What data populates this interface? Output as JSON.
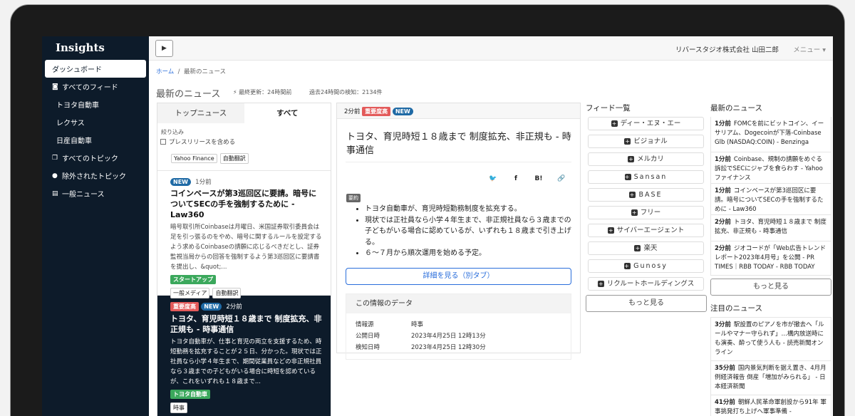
{
  "sidebar": {
    "brand": "Insights",
    "items": [
      {
        "label": "ダッシュボード",
        "icon": ""
      },
      {
        "label": "すべてのフィード",
        "icon": "rss-icon"
      },
      {
        "label": "トヨタ自動車",
        "icon": ""
      },
      {
        "label": "レクサス",
        "icon": ""
      },
      {
        "label": "日産自動車",
        "icon": ""
      },
      {
        "label": "すべてのトピック",
        "icon": "copy-icon"
      },
      {
        "label": "除外されたトピック",
        "icon": "exclamation-icon"
      },
      {
        "label": "一般ニュース",
        "icon": "newspaper-icon"
      }
    ]
  },
  "topbar": {
    "toggle_glyph": "▶",
    "user": "リバースタジオ株式会社 山田二郎",
    "menu": "メニュー ▾"
  },
  "breadcrumb": {
    "home": "ホーム",
    "sep": "/",
    "current": "最新のニュース"
  },
  "page": {
    "title": "最新のニュース",
    "last_update": "⚡ 最終更新：24時間前",
    "detected": "過去24時間の検知：2134件"
  },
  "list": {
    "tabs": {
      "top": "トップニュース",
      "all": "すべて"
    },
    "filter_title": "絞り込み",
    "filter_checkbox": "プレスリリースを含める",
    "top_tags": [
      "Yahoo Finance",
      "自動翻訳"
    ],
    "items": [
      {
        "badge_new": "NEW",
        "time": "1分前",
        "title": "コインベースが第3巡回区に要請。暗号についてSECの手を強制するために - Law360",
        "body": "暗号取引所Coinbaseは月曜日、米国証券取引委員会は足を引っ張るのをやめ、暗号に関するルールを設定するよう求めるCoinbaseの請願に応じるべきだとし、証券監視当局からの回答を強制するよう第3巡回区に要請書を提出し、&quot;...",
        "category": "スタートアップ",
        "tags": [
          "一般メディア",
          "自動翻訳"
        ]
      },
      {
        "badge_important": "重要度高",
        "badge_new": "NEW",
        "time": "2分前",
        "title": "トヨタ、育児時短１８歳まで 制度拡充、非正規も - 時事通信",
        "body": "トヨタ自動車が、仕事と育児の両立を支援するため、時短勤務を拡充することが２５日、分かった。現状では正社員なら小学４年生まで、期間従業員などの非正規社員なら３歳までの子どもがいる場合に時短を認めているが、これをいずれも１８歳まで...",
        "category": "トヨタ自動車",
        "tags": [
          "時事"
        ]
      }
    ]
  },
  "detail": {
    "time": "2分前",
    "badge_important": "重要度高",
    "badge_new": "NEW",
    "title": "トヨタ、育児時短１８歳まで 制度拡充、非正規も - 時事通信",
    "share": {
      "twitter": "twitter-icon",
      "facebook": "facebook-icon",
      "hatena": "B!",
      "link": "link-icon"
    },
    "summary_badge": "要約",
    "summary": [
      "トヨタ自動車が、育児時短勤務制度を拡充する。",
      "現状では正社員なら小学４年生まで、非正規社員なら３歳までの子どもがいる場合に認めているが、いずれも１８歳まで引き上げる。",
      "６～７月から順次運用を始める予定。"
    ],
    "detail_button": "詳細を見る（別タブ）",
    "data_title": "この情報のデータ",
    "data_rows": [
      {
        "k": "情報源",
        "v": "時事"
      },
      {
        "k": "公開日時",
        "v": "2023年4月25日 12時13分"
      },
      {
        "k": "検知日時",
        "v": "2023年4月25日 12時30分"
      }
    ]
  },
  "feeds": {
    "title": "フィード一覧",
    "items": [
      "ディー・エヌ・エー",
      "ビジョナル",
      "メルカリ",
      "Sansan",
      "BASE",
      "フリー",
      "サイバーエージェント",
      "楽天",
      "Gunosy",
      "リクルートホールディングス"
    ],
    "more": "もっと見る"
  },
  "news": {
    "title": "最新のニュース",
    "items": [
      {
        "time": "1分前",
        "text": "FOMCを前にビットコイン、イーサリアム、Dogecoinが下落-Coinbase Glb (NASDAQ:COIN) - Benzinga"
      },
      {
        "time": "1分前",
        "text": "Coinbase、規制の請願をめぐる訴訟でSECにジャブを食らわす - Yahoo ファイナンス"
      },
      {
        "time": "1分前",
        "text": "コインベースが第3巡回区に要請。暗号についてSECの手を強制するために - Law360"
      },
      {
        "time": "2分前",
        "text": "トヨタ、育児時短１８歳まで 制度拡充、非正規も - 時事通信"
      },
      {
        "time": "2分前",
        "text": "ジオコードが「Web広告トレンドレポート2023年4月号」を公開 - PR TIMES｜RBB TODAY - RBB TODAY"
      }
    ],
    "more": "もっと見る",
    "hot_title": "注目のニュース",
    "hot": [
      {
        "time": "3分前",
        "text": "駅設置のピアノを市が撤去へ「ルールやマナー守られず」…構内放送時にも演奏、酔って使う人も - 読売新聞オンライン"
      },
      {
        "time": "35分前",
        "text": "国内景気判断を据え置き、4月月例経済報告 倒産「増加がみられる」 - 日本経済新聞"
      },
      {
        "time": "41分前",
        "text": "朝鮮人民革命軍創設から91年 軍事挑発打ち上げへ軍事準備 -"
      }
    ]
  }
}
